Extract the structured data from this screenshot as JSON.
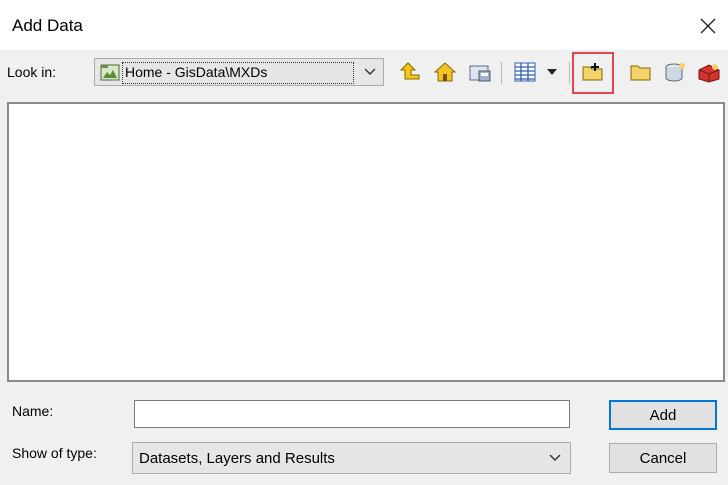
{
  "window": {
    "title": "Add Data"
  },
  "lookin": {
    "label": "Look in:",
    "value": "Home - GisData\\MXDs"
  },
  "form": {
    "name_label": "Name:",
    "name_value": "",
    "type_label": "Show of type:",
    "type_value": "Datasets, Layers and Results"
  },
  "buttons": {
    "add": "Add",
    "cancel": "Cancel"
  },
  "colors": {
    "highlight": "#e8434a",
    "default_border": "#0078d7"
  }
}
